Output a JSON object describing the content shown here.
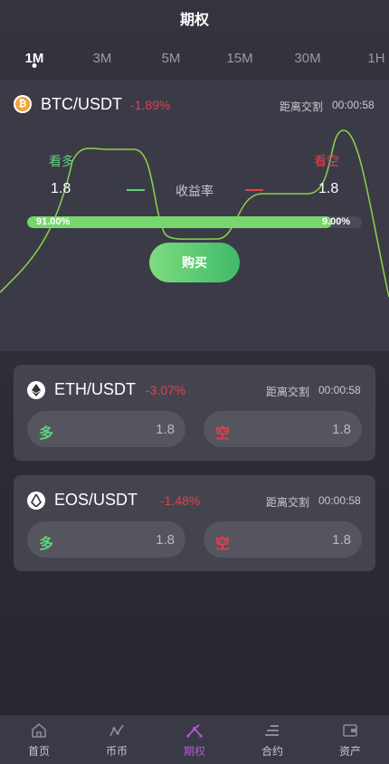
{
  "header": {
    "title": "期权"
  },
  "tabs": [
    {
      "label": "1M",
      "active": true
    },
    {
      "label": "3M"
    },
    {
      "label": "5M"
    },
    {
      "label": "15M"
    },
    {
      "label": "30M"
    },
    {
      "label": "1H"
    }
  ],
  "hero": {
    "pair": "BTC/USDT",
    "change": "-1.89%",
    "countdown_label": "距离交割",
    "countdown": "00:00:58",
    "bull_label": "看多",
    "bear_label": "看空",
    "rate_left": "1.8",
    "rate_right": "1.8",
    "rate_label": "收益率",
    "bull_percent_text": "91.00%",
    "bear_percent_text": "9.00%",
    "bull_fraction": 0.91,
    "buy_label": "购买",
    "icon": "bitcoin-icon"
  },
  "cards": [
    {
      "pair": "ETH/USDT",
      "change": "-3.07%",
      "countdown_label": "距离交割",
      "countdown": "00:00:58",
      "long_label": "多",
      "long_rate": "1.8",
      "short_label": "空",
      "short_rate": "1.8",
      "icon": "ethereum-icon"
    },
    {
      "pair": "EOS/USDT",
      "change": "-1.48%",
      "countdown_label": "距离交割",
      "countdown": "00:00:58",
      "long_label": "多",
      "long_rate": "1.8",
      "short_label": "空",
      "short_rate": "1.8",
      "icon": "eos-icon"
    }
  ],
  "nav": [
    {
      "label": "首页",
      "icon": "home-icon"
    },
    {
      "label": "币币",
      "icon": "coin-exchange-icon"
    },
    {
      "label": "期权",
      "icon": "options-icon",
      "active": true
    },
    {
      "label": "合约",
      "icon": "contract-icon"
    },
    {
      "label": "资产",
      "icon": "wallet-icon"
    }
  ],
  "colors": {
    "up": "#5fd37a",
    "down": "#e0414f",
    "accent": "#b35ad1"
  }
}
